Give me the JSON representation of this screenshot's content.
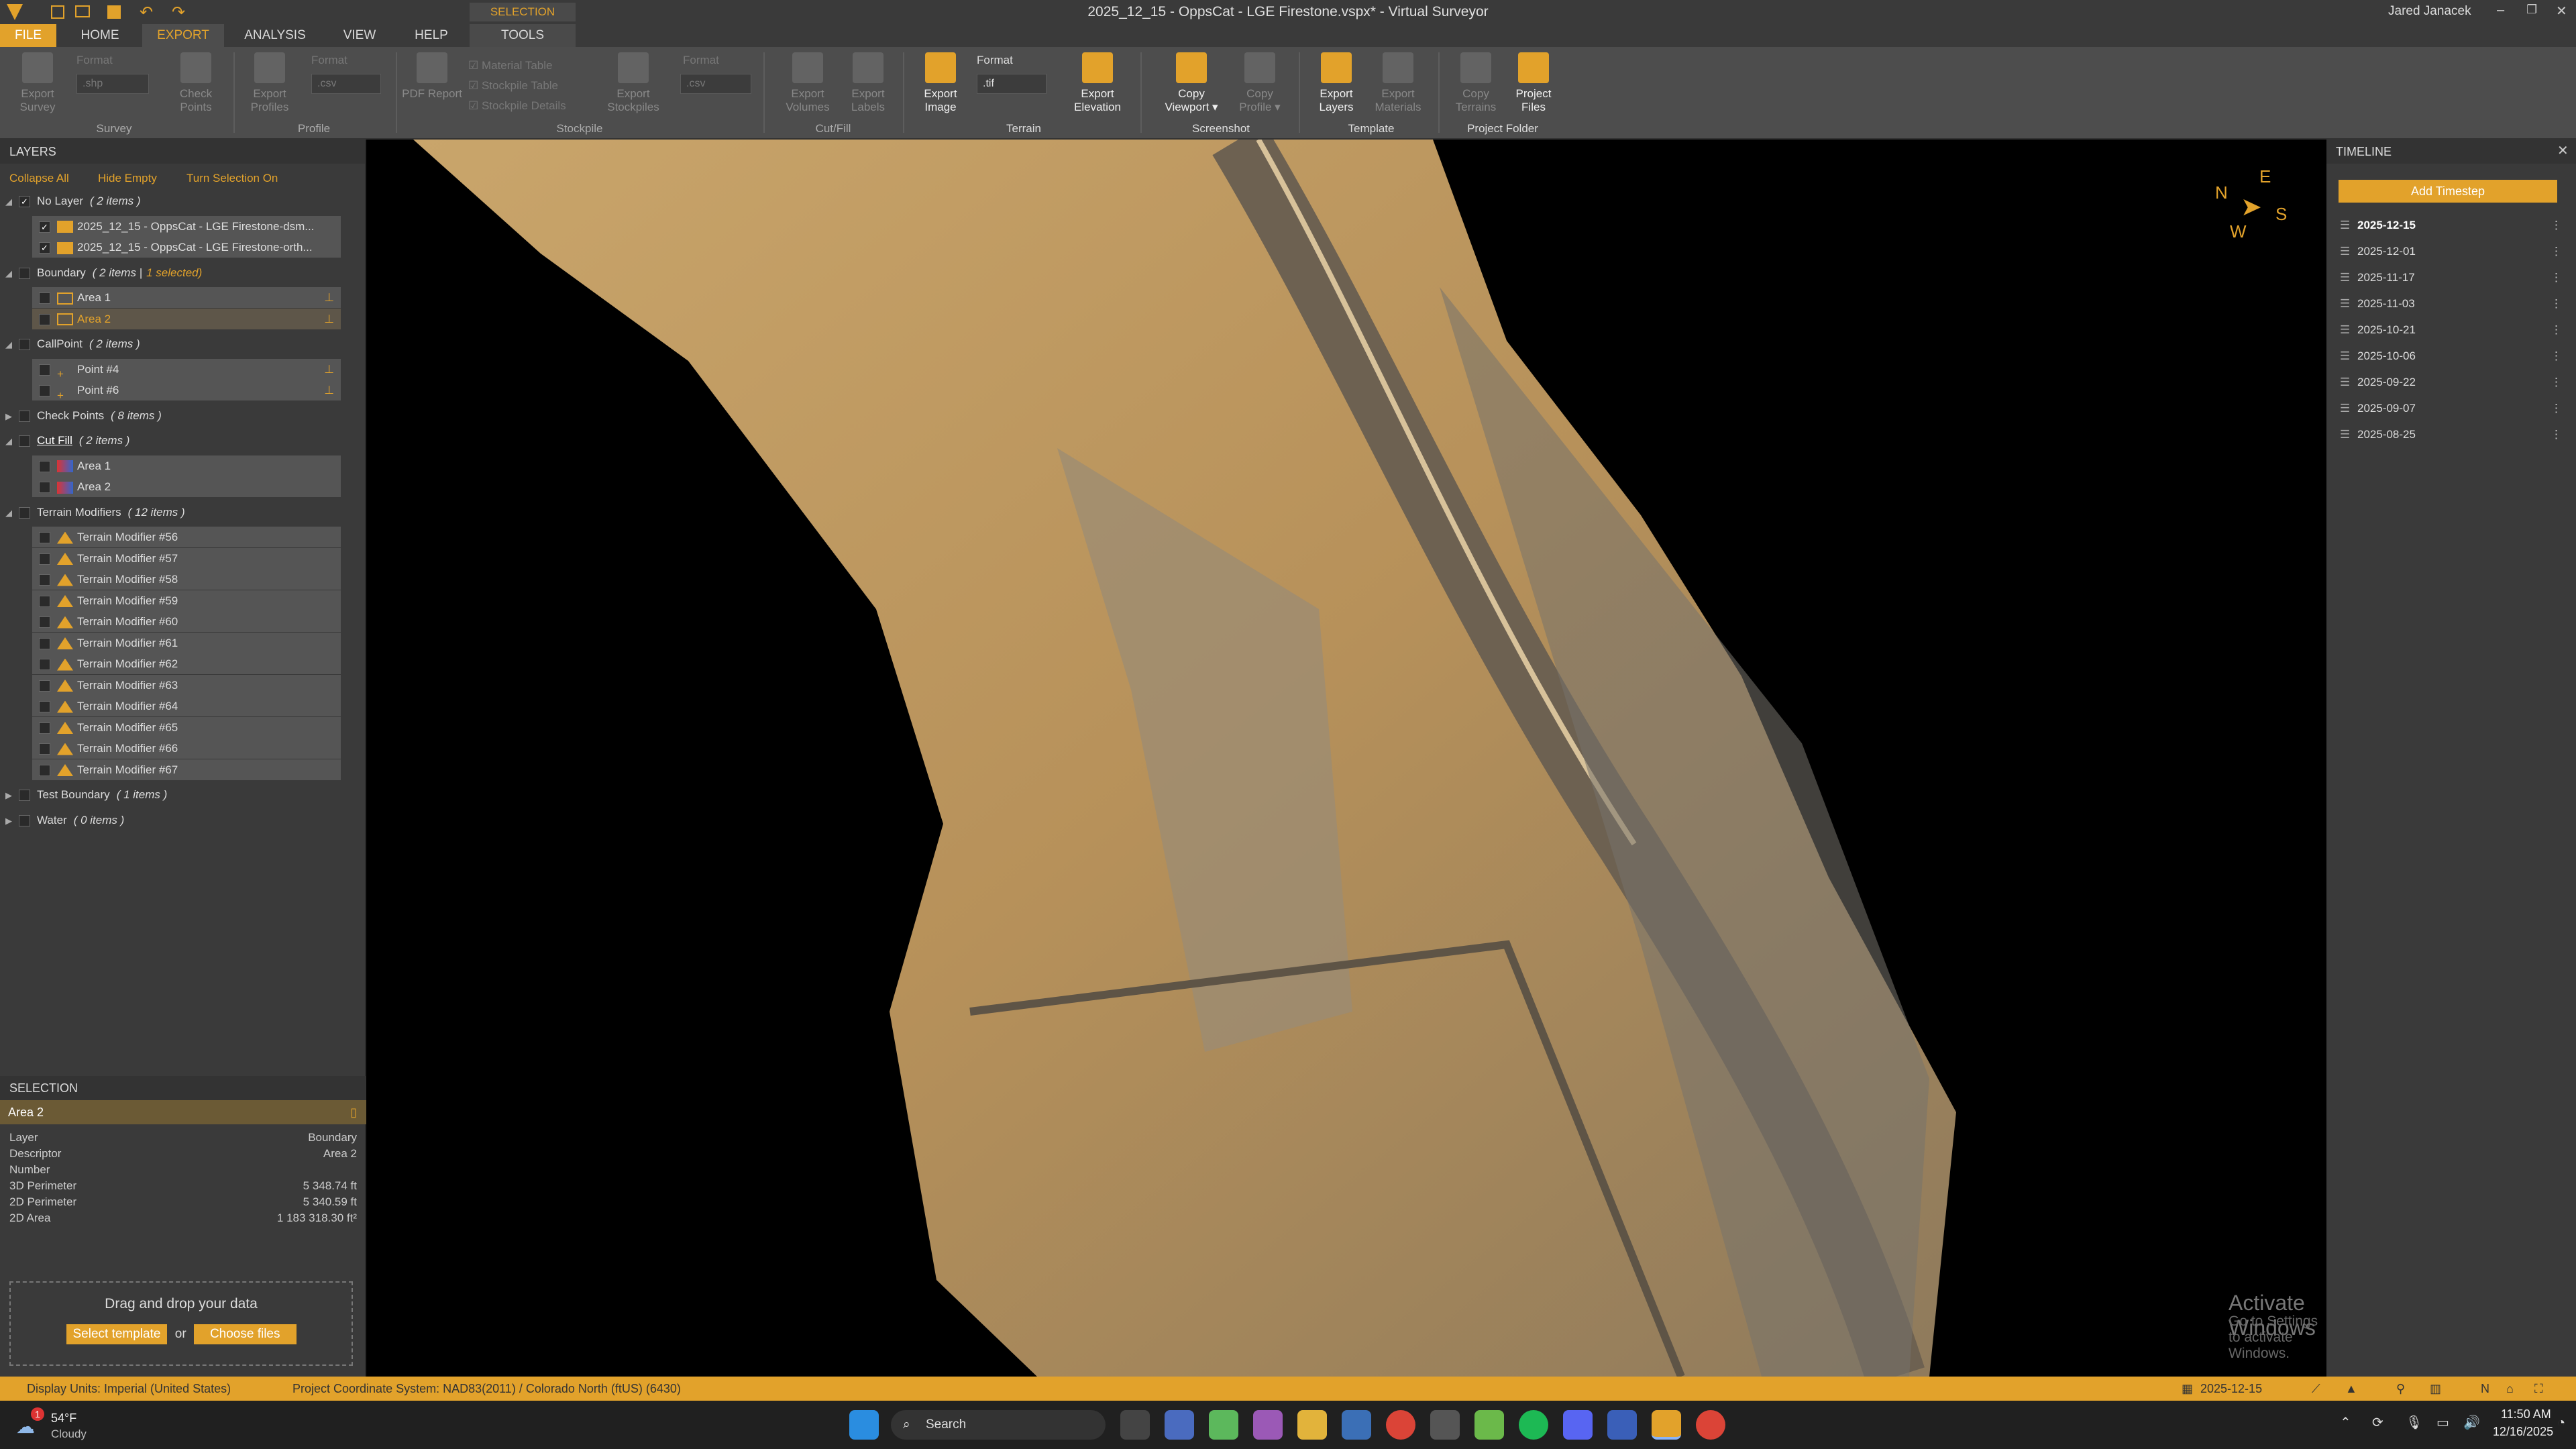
{
  "window": {
    "title": "2025_12_15 - OppsCat - LGE Firestone.vspx* - Virtual Surveyor",
    "user": "Jared Janacek"
  },
  "ribbon_tabs": [
    "FILE",
    "HOME",
    "EXPORT",
    "ANALYSIS",
    "VIEW",
    "HELP",
    "TOOLS"
  ],
  "ribbon_context": "SELECTION",
  "ribbon": {
    "format_label": "Format",
    "format_label2": "Format",
    "format_label3": "Format",
    "format_label4": "Format",
    "survey_fmt": ".shp",
    "profile_fmt": ".csv",
    "stockpile_fmt": ".csv",
    "terrain_fmt": ".tif",
    "buttons": {
      "export_survey": "Export Survey",
      "check_points": "Check Points",
      "export_profiles": "Export Profiles",
      "pdf_report": "PDF Report",
      "export_stockpiles": "Export Stockpiles",
      "export_volumes": "Export Volumes",
      "export_labels": "Export Labels",
      "export_image": "Export Image",
      "export_elevation": "Export Elevation",
      "copy_viewport": "Copy Viewport ▾",
      "copy_profile": "Copy Profile ▾",
      "export_layers": "Export Layers",
      "export_materials": "Export Materials",
      "copy_terrains": "Copy Terrains",
      "project_files": "Project Files"
    },
    "checks": [
      "Material Table",
      "Stockpile Table",
      "Stockpile Details"
    ],
    "groups": {
      "survey": "Survey",
      "profile": "Profile",
      "stockpile": "Stockpile",
      "cutfill": "Cut/Fill",
      "terrain": "Terrain",
      "screenshot": "Screenshot",
      "template": "Template",
      "project_folder": "Project Folder"
    }
  },
  "layers": {
    "title": "LAYERS",
    "collapse_all": "Collapse All",
    "hide_empty": "Hide Empty",
    "turn_selection_on": "Turn Selection On",
    "groups": [
      {
        "name": "No Layer",
        "count": "( 2 items )",
        "items": [
          "2025_12_15 - OppsCat - LGE Firestone-dsm...",
          "2025_12_15 - OppsCat - LGE Firestone-orth..."
        ]
      },
      {
        "name": "Boundary",
        "count": "( 2 items |",
        "selected": "1 selected)",
        "items": [
          "Area 1",
          "Area 2"
        ]
      },
      {
        "name": "CallPoint",
        "count": "( 2 items )",
        "items": [
          "Point #4",
          "Point #6"
        ]
      },
      {
        "name": "Check Points",
        "count": "( 8 items )"
      },
      {
        "name": "Cut Fill",
        "count": "( 2 items )",
        "items": [
          "Area 1",
          "Area 2"
        ]
      },
      {
        "name": "Terrain Modifiers",
        "count": "( 12 items )",
        "items": [
          "Terrain Modifier #56",
          "Terrain Modifier #57",
          "Terrain Modifier #58",
          "Terrain Modifier #59",
          "Terrain Modifier #60",
          "Terrain Modifier #61",
          "Terrain Modifier #62",
          "Terrain Modifier #63",
          "Terrain Modifier #64",
          "Terrain Modifier #65",
          "Terrain Modifier #66",
          "Terrain Modifier #67"
        ]
      },
      {
        "name": "Test Boundary",
        "count": "( 1 items )"
      },
      {
        "name": "Water",
        "count": "( 0 items )"
      }
    ]
  },
  "selection": {
    "title": "SELECTION",
    "name": "Area 2",
    "props": [
      [
        "Layer",
        "Boundary"
      ],
      [
        "Descriptor",
        "Area 2"
      ],
      [
        "Number",
        ""
      ],
      [
        "3D Perimeter",
        "5 348.74 ft"
      ],
      [
        "2D Perimeter",
        "5 340.59 ft"
      ],
      [
        "2D Area",
        "1 183 318.30 ft²"
      ]
    ],
    "drop_text": "Drag and drop your data",
    "select_template": "Select template",
    "or": "or",
    "choose_files": "Choose files"
  },
  "compass": {
    "n": "N",
    "e": "E",
    "s": "S",
    "w": "W"
  },
  "watermark": {
    "line1": "Activate Windows",
    "line2": "Go to Settings to activate Windows."
  },
  "timeline": {
    "title": "TIMELINE",
    "add": "Add Timestep",
    "dates": [
      "2025-12-15",
      "2025-12-01",
      "2025-11-17",
      "2025-11-03",
      "2025-10-21",
      "2025-10-06",
      "2025-09-22",
      "2025-09-07",
      "2025-08-25"
    ]
  },
  "status": {
    "units": "Display Units:  Imperial (United States)",
    "crs": "Project Coordinate System:  NAD83(2011) / Colorado North (ftUS) (6430)",
    "date": "2025-12-15"
  },
  "taskbar": {
    "temp": "54°F",
    "weather": "Cloudy",
    "badge": "1",
    "search": "Search",
    "time": "11:50 AM",
    "date": "12/16/2025"
  },
  "colors": {
    "accent": "#e2a22b",
    "panel": "#3a3a3a",
    "map_bg": "#000000"
  }
}
